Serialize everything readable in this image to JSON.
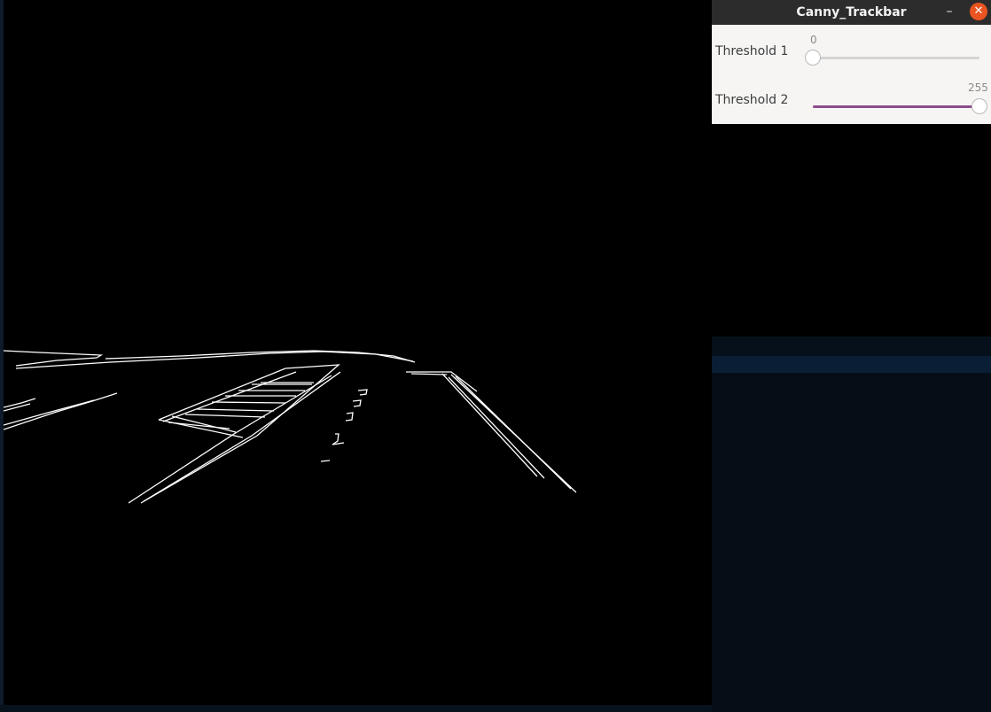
{
  "window": {
    "title": "Canny_Trackbar",
    "minimize_glyph": "–",
    "close_glyph": "✕"
  },
  "trackbars": [
    {
      "label": "Threshold 1",
      "value": "0",
      "max": 255
    },
    {
      "label": "Threshold 2",
      "value": "255",
      "max": 255
    }
  ],
  "colors": {
    "titlebar": "#2c2c2c",
    "close_button": "#e95420",
    "slider_fill": "#8c4d8c",
    "panel_bg": "#f6f5f4",
    "edge": "#ffffff"
  },
  "image": {
    "content": "canny-edge-output"
  }
}
